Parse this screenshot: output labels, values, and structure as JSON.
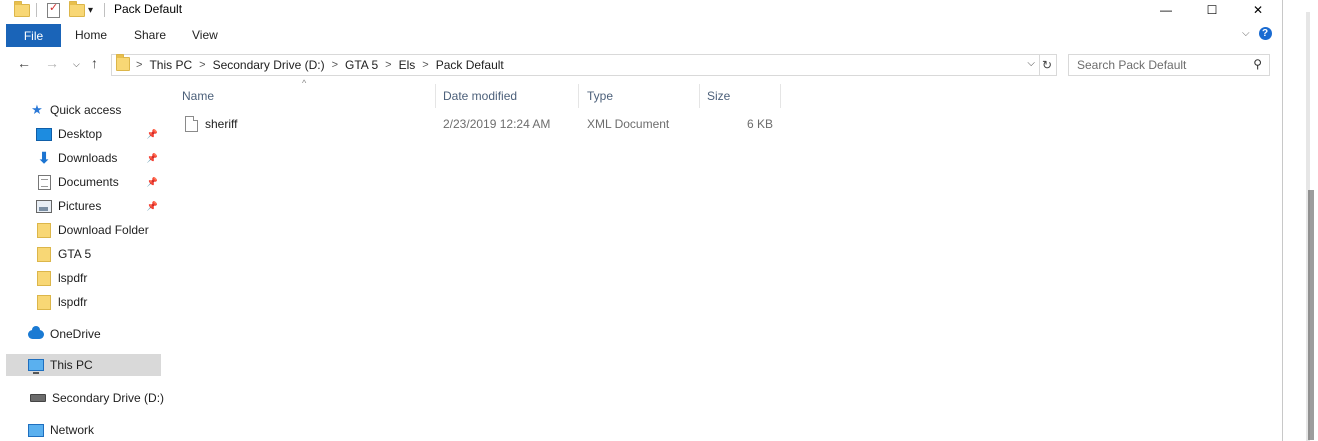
{
  "window": {
    "title": "Pack Default",
    "minimize_glyph": "—",
    "maximize_glyph": "☐",
    "close_glyph": "✕"
  },
  "ribbon": {
    "tabs": [
      "File",
      "Home",
      "Share",
      "View"
    ],
    "help_glyph": "?"
  },
  "address": {
    "crumbs": [
      "This PC",
      "Secondary Drive (D:)",
      "GTA 5",
      "Els",
      "Pack Default"
    ],
    "separator": ">"
  },
  "search": {
    "placeholder": "Search Pack Default"
  },
  "navigation": {
    "quick_access": "Quick access",
    "items": [
      {
        "label": "Desktop",
        "icon": "desktop-icon",
        "pinned": true
      },
      {
        "label": "Downloads",
        "icon": "download-icon",
        "pinned": true
      },
      {
        "label": "Documents",
        "icon": "documents-icon",
        "pinned": true
      },
      {
        "label": "Pictures",
        "icon": "pictures-icon",
        "pinned": true
      },
      {
        "label": "Download Folder",
        "icon": "folder-icon",
        "pinned": false
      },
      {
        "label": "GTA 5",
        "icon": "folder-icon",
        "pinned": false
      },
      {
        "label": "lspdfr",
        "icon": "folder-icon",
        "pinned": false
      },
      {
        "label": "lspdfr",
        "icon": "folder-icon",
        "pinned": false
      }
    ],
    "onedrive": "OneDrive",
    "this_pc": "This PC",
    "drive": "Secondary Drive (D:)",
    "network": "Network"
  },
  "file_list": {
    "columns": [
      "Name",
      "Date modified",
      "Type",
      "Size"
    ],
    "rows": [
      {
        "name": "sheriff",
        "date": "2/23/2019 12:24 AM",
        "type": "XML Document",
        "size": "6 KB"
      }
    ]
  },
  "colors": {
    "file_tab": "#1a64b8",
    "selected_nav": "#d9d9d9",
    "folder": "#f8d775",
    "header_text": "#4c607a"
  }
}
